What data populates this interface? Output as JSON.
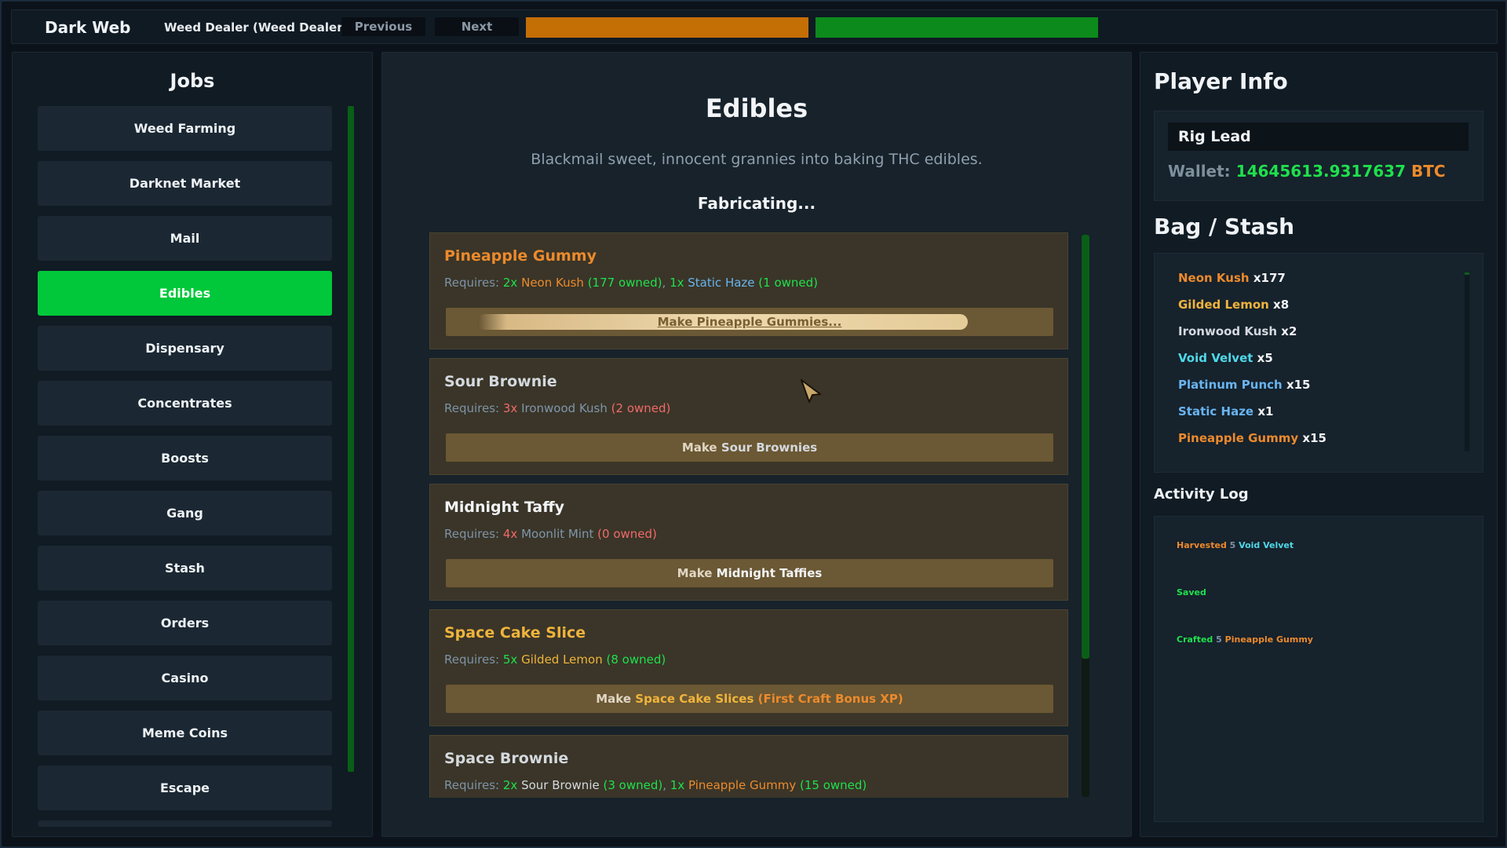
{
  "header": {
    "app_title": "Dark Web",
    "job_title": "Weed Dealer (Weed Dealer)",
    "prev_label": "Previous",
    "next_label": "Next",
    "bar_colors": [
      "#c46e06",
      "#0d8a1c"
    ]
  },
  "sidebar": {
    "title": "Jobs",
    "items": [
      {
        "label": "Weed Farming",
        "active": false
      },
      {
        "label": "Darknet Market",
        "active": false
      },
      {
        "label": "Mail",
        "active": false
      },
      {
        "label": "Edibles",
        "active": true
      },
      {
        "label": "Dispensary",
        "active": false
      },
      {
        "label": "Concentrates",
        "active": false
      },
      {
        "label": "Boosts",
        "active": false
      },
      {
        "label": "Gang",
        "active": false
      },
      {
        "label": "Stash",
        "active": false
      },
      {
        "label": "Orders",
        "active": false
      },
      {
        "label": "Casino",
        "active": false
      },
      {
        "label": "Meme Coins",
        "active": false
      },
      {
        "label": "Escape",
        "active": false
      }
    ]
  },
  "main": {
    "title": "Edibles",
    "description": "Blackmail sweet, innocent grannies into baking THC edibles.",
    "status": "Fabricating...",
    "recipes": [
      {
        "name": "Pineapple Gummy",
        "requires_label": "Requires:",
        "ingredients": [
          {
            "qty": "2x",
            "name": "Neon Kush",
            "owned": "(177 owned)",
            "suffix": ","
          },
          {
            "qty": "1x",
            "name": "Static Haze",
            "owned": "(1 owned)",
            "suffix": ""
          }
        ],
        "button_text": "Make Pineapple Gummies...",
        "in_progress": true
      },
      {
        "name": "Sour Brownie",
        "requires_label": "Requires:",
        "ingredients": [
          {
            "qty": "3x",
            "name": "Ironwood Kush",
            "owned": "(2 owned)",
            "suffix": ""
          }
        ],
        "button_prefix": "Make",
        "button_item": "Sour Brownies",
        "button_bonus": ""
      },
      {
        "name": "Midnight Taffy",
        "requires_label": "Requires:",
        "ingredients": [
          {
            "qty": "4x",
            "name": "Moonlit Mint",
            "owned": "(0 owned)",
            "suffix": ""
          }
        ],
        "button_prefix": "Make",
        "button_item": "Midnight Taffies",
        "button_bonus": ""
      },
      {
        "name": "Space Cake Slice",
        "requires_label": "Requires:",
        "ingredients": [
          {
            "qty": "5x",
            "name": "Gilded Lemon",
            "owned": "(8 owned)",
            "suffix": ""
          }
        ],
        "button_prefix": "Make",
        "button_item": "Space Cake Slices",
        "button_bonus": "(First Craft Bonus XP)"
      },
      {
        "name": "Space Brownie",
        "requires_label": "Requires:",
        "ingredients": [
          {
            "qty": "2x",
            "name": "Sour Brownie",
            "owned": "(3 owned)",
            "suffix": ","
          },
          {
            "qty": "1x",
            "name": "Pineapple Gummy",
            "owned": "(15 owned)",
            "suffix": ""
          }
        ]
      }
    ]
  },
  "player": {
    "section_title": "Player Info",
    "name": "Rig Lead",
    "wallet_label": "Wallet:",
    "wallet_amount": "14645613.9317637",
    "wallet_unit": "BTC"
  },
  "stash": {
    "section_title": "Bag / Stash",
    "items": [
      {
        "name": "Neon Kush",
        "qty": "x177"
      },
      {
        "name": "Gilded Lemon",
        "qty": "x8"
      },
      {
        "name": "Ironwood Kush",
        "qty": "x2"
      },
      {
        "name": "Void Velvet",
        "qty": "x5"
      },
      {
        "name": "Platinum Punch",
        "qty": "x15"
      },
      {
        "name": "Static Haze",
        "qty": "x1"
      },
      {
        "name": "Pineapple Gummy",
        "qty": "x15"
      }
    ]
  },
  "activity": {
    "title": "Activity Log",
    "entries": [
      {
        "verb": "Harvested",
        "count": "5",
        "item": "Void Velvet"
      },
      {
        "verb": "Saved",
        "count": "",
        "item": ""
      },
      {
        "verb": "Crafted",
        "count": "5",
        "item": "Pineapple Gummy"
      }
    ]
  }
}
